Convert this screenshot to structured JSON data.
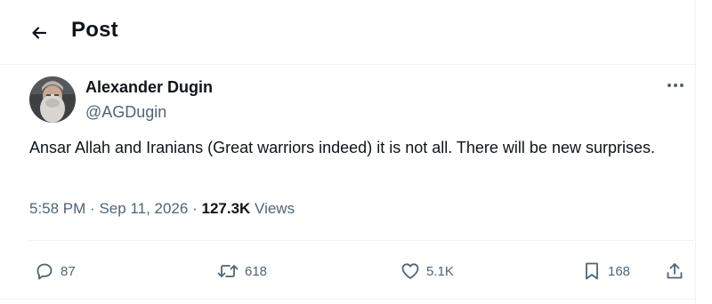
{
  "header": {
    "title": "Post"
  },
  "author": {
    "name": "Alexander Dugin",
    "handle": "@AGDugin"
  },
  "tweet": {
    "text": "Ansar Allah and Iranians (Great warriors indeed) it is not all. There will be new surprises."
  },
  "meta": {
    "time": "5:58 PM",
    "date": "Sep 11, 2026",
    "views_count": "127.3K",
    "views_label": "Views",
    "sep": "·"
  },
  "actions": {
    "replies": "87",
    "reposts": "618",
    "likes": "5.1K",
    "bookmarks": "168"
  },
  "icons": {
    "back": "arrow-left-icon",
    "more": "ellipsis-icon",
    "reply": "reply-icon",
    "repost": "repost-icon",
    "like": "heart-icon",
    "bookmark": "bookmark-icon",
    "share": "share-icon"
  },
  "colors": {
    "text": "#0f1419",
    "secondary": "#536471",
    "divider": "#eff3f4"
  }
}
